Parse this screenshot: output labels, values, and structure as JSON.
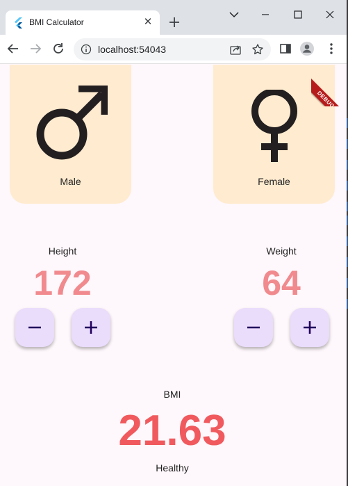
{
  "browser": {
    "tab_title": "BMI Calculator",
    "url": "localhost:54043",
    "icons": {
      "tab": "flutter-logo-icon",
      "close_tab": "close-icon",
      "new_tab": "plus-icon",
      "tab_search": "chevron-down-icon",
      "minimize": "minimize-icon",
      "maximize": "maximize-icon",
      "close_window": "close-icon",
      "back": "arrow-left-icon",
      "forward": "arrow-right-icon",
      "reload": "reload-icon",
      "site_info": "info-icon",
      "share": "share-icon",
      "bookmark": "star-icon",
      "side_panel": "side-panel-icon",
      "profile": "profile-icon",
      "menu": "kebab-menu-icon"
    },
    "colors": {
      "titlebar": "#dee1e6",
      "toolbar": "#ffffff",
      "omnibox": "#f1f3f4"
    }
  },
  "app": {
    "debug_banner": "DEBUG",
    "gender": {
      "male": {
        "label": "Male",
        "icon": "male-symbol-icon"
      },
      "female": {
        "label": "Female",
        "icon": "female-symbol-icon"
      }
    },
    "height": {
      "label": "Height",
      "value": "172"
    },
    "weight": {
      "label": "Weight",
      "value": "64"
    },
    "stepper_icons": {
      "decrement": "minus-icon",
      "increment": "plus-icon"
    },
    "bmi": {
      "label": "BMI",
      "value": "21.63",
      "status": "Healthy"
    },
    "colors": {
      "background": "#fef7fb",
      "card": "#ffebcf",
      "metric_value": "#f08a8e",
      "bmi_value": "#f05a5e",
      "button": "#eadcfb",
      "button_icon": "#21005d",
      "debug_ribbon": "#b71c1c"
    }
  }
}
